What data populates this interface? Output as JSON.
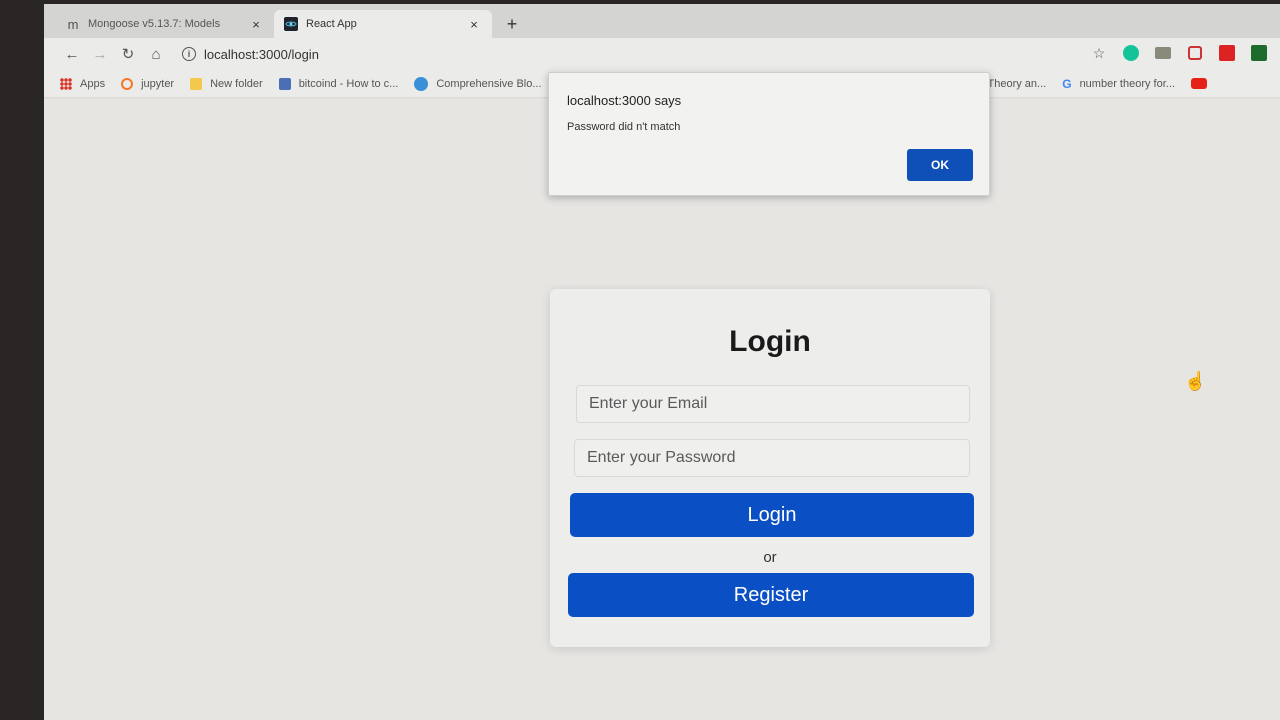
{
  "tabs": [
    {
      "title": "Mongoose v5.13.7: Models",
      "icon": "mongoose-icon",
      "close": "×"
    },
    {
      "title": "React App",
      "icon": "react-icon",
      "close": "×"
    }
  ],
  "new_tab": "+",
  "toolbar": {
    "url": "localhost:3000/login"
  },
  "bookmarks": [
    {
      "label": "Apps",
      "icon": "apps-grid-icon",
      "color": "#d93025"
    },
    {
      "label": "jupyter",
      "icon": "jupyter-icon",
      "color": "#f37726"
    },
    {
      "label": "New folder",
      "icon": "folder-icon",
      "color": "#f2c94c"
    },
    {
      "label": "bitcoind - How to c...",
      "icon": "site-icon",
      "color": "#4a6fb5"
    },
    {
      "label": "Comprehensive Blo...",
      "icon": "globe-icon",
      "color": "#3a8fd6"
    },
    {
      "label": "Theory an...",
      "icon": "page-icon",
      "color": "#999999"
    },
    {
      "label": "number theory for...",
      "icon": "google-icon",
      "color": "#4285f4"
    }
  ],
  "alert": {
    "title": "localhost:3000 says",
    "message": "Password did n't match",
    "ok_label": "OK"
  },
  "login": {
    "heading": "Login",
    "email_placeholder": "Enter your Email",
    "password_placeholder": "Enter your Password",
    "login_label": "Login",
    "or_text": "or",
    "register_label": "Register"
  },
  "colors": {
    "primary": "#0a4fc4",
    "ok_button": "#0f4fb8"
  }
}
